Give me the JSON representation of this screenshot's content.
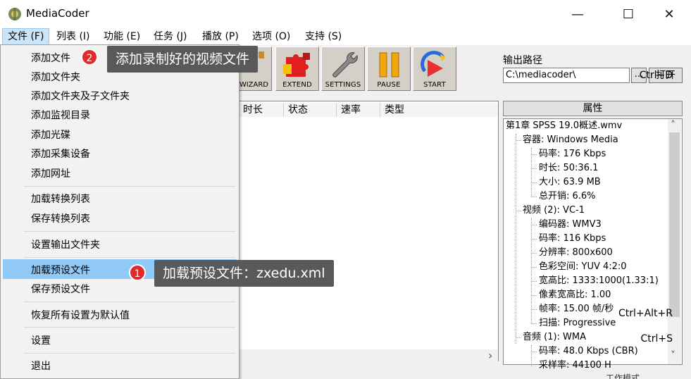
{
  "window": {
    "title": "MediaCoder",
    "minimize": "—",
    "maximize": "☐",
    "close": "✕"
  },
  "menubar": [
    "文件 (F)",
    "列表 (I)",
    "功能 (E)",
    "任务 (J)",
    "播放 (P)",
    "选项 (O)",
    "支持 (S)"
  ],
  "toolbar": {
    "wizard": "WIZARD",
    "extend": "EXTEND",
    "settings": "SETTINGS",
    "pause": "PAUSE",
    "start": "START"
  },
  "output": {
    "label": "输出路径",
    "path": "C:\\mediacoder\\",
    "browse": "...",
    "open": "打开"
  },
  "filelist": {
    "columns": [
      "时长",
      "状态",
      "速率",
      "类型"
    ]
  },
  "properties": {
    "header": "属性",
    "tree": [
      "第1章 SPSS 19.0概述.wmv",
      "容器: Windows Media",
      "码率: 176 Kbps",
      "时长: 50:36.1",
      "大小: 63.9 MB",
      "总开销: 6.6%",
      "视频 (2): VC-1",
      "编码器: WMV3",
      "码率: 116 Kbps",
      "分辨率: 800x600",
      "色彩空间: YUV 4:2:0",
      "宽高比: 1333:1000(1.33:1)",
      "像素宽高比: 1.00",
      "帧率: 15.00 帧/秒",
      "扫描: Progressive",
      "音频 (1): WMA",
      "码率: 48.0 Kbps (CBR)",
      "采样率: 44100 H"
    ]
  },
  "file_menu": {
    "items": [
      {
        "label": "添加文件",
        "shortcut": ""
      },
      {
        "label": "添加文件夹",
        "shortcut": "Ctrl+D"
      },
      {
        "label": "添加文件夹及子文件夹",
        "shortcut": ""
      },
      {
        "label": "添加监视目录",
        "shortcut": ""
      },
      {
        "label": "添加光碟",
        "shortcut": ""
      },
      {
        "label": "添加采集设备",
        "shortcut": ""
      },
      {
        "label": "添加网址",
        "shortcut": ""
      },
      {
        "label": "加载转换列表",
        "shortcut": ""
      },
      {
        "label": "保存转换列表",
        "shortcut": ""
      },
      {
        "label": "设置输出文件夹",
        "shortcut": ""
      },
      {
        "label": "加载预设文件",
        "shortcut": ""
      },
      {
        "label": "保存预设文件",
        "shortcut": ""
      },
      {
        "label": "恢复所有设置为默认值",
        "shortcut": "Ctrl+Alt+R"
      },
      {
        "label": "设置",
        "shortcut": "Ctrl+S"
      },
      {
        "label": "退出",
        "shortcut": ""
      }
    ]
  },
  "callouts": [
    {
      "number": "2",
      "text": "添加录制好的视频文件"
    },
    {
      "number": "1",
      "text": "加载预设文件：zxedu.xml"
    }
  ],
  "scroll": {
    "right_arrow": "›",
    "up_arrow": "˄",
    "down_arrow": "˅"
  },
  "bottom_partial_text": "工作模式",
  "colors": {
    "highlight": "#91c9f7",
    "callout_bg": "#595959",
    "badge": "#e02a2a",
    "pause_yellow": "#f2a80c"
  }
}
